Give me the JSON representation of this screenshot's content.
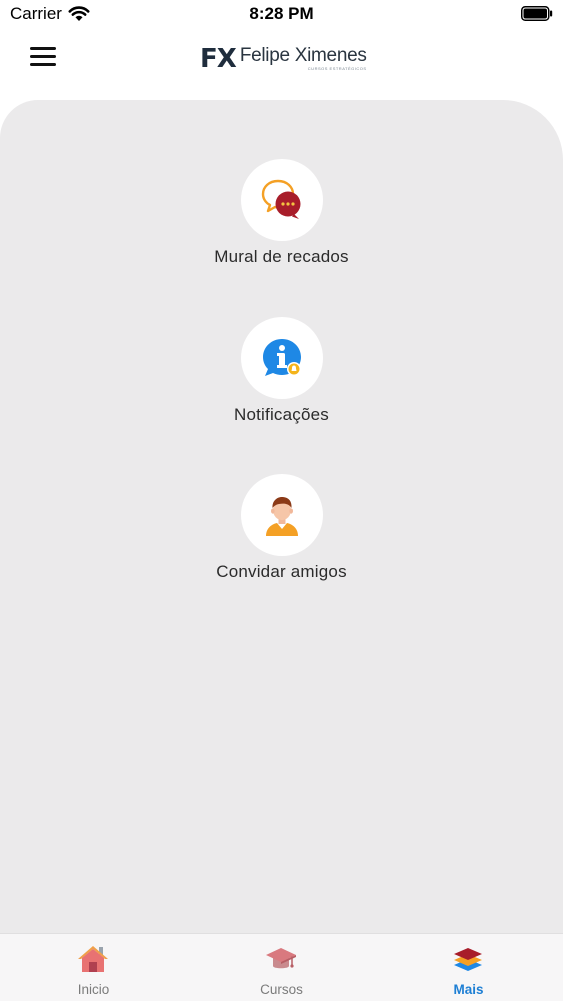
{
  "status_bar": {
    "carrier": "Carrier",
    "time": "8:28 PM"
  },
  "header": {
    "logo_mark": "FX",
    "logo_text": "Felipe Ximenes",
    "logo_subtext": "CURSOS ESTRATÉGICOS"
  },
  "menu": {
    "items": [
      {
        "label": "Mural de recados",
        "icon": "chat-bubbles-icon"
      },
      {
        "label": "Notificações",
        "icon": "info-bubble-icon"
      },
      {
        "label": "Convidar amigos",
        "icon": "person-avatar-icon"
      }
    ]
  },
  "tabbar": {
    "tabs": [
      {
        "label": "Inicio",
        "icon": "home-icon"
      },
      {
        "label": "Cursos",
        "icon": "graduation-cap-icon"
      },
      {
        "label": "Mais",
        "icon": "layers-icon",
        "active": true
      }
    ]
  },
  "colors": {
    "panel_bg": "#ebeaeb",
    "active_tab": "#1e7fd4",
    "inactive_tab": "#7b7b7b",
    "accent_red": "#a81d2a",
    "accent_blue": "#1e88e5",
    "accent_orange": "#f4a025"
  }
}
